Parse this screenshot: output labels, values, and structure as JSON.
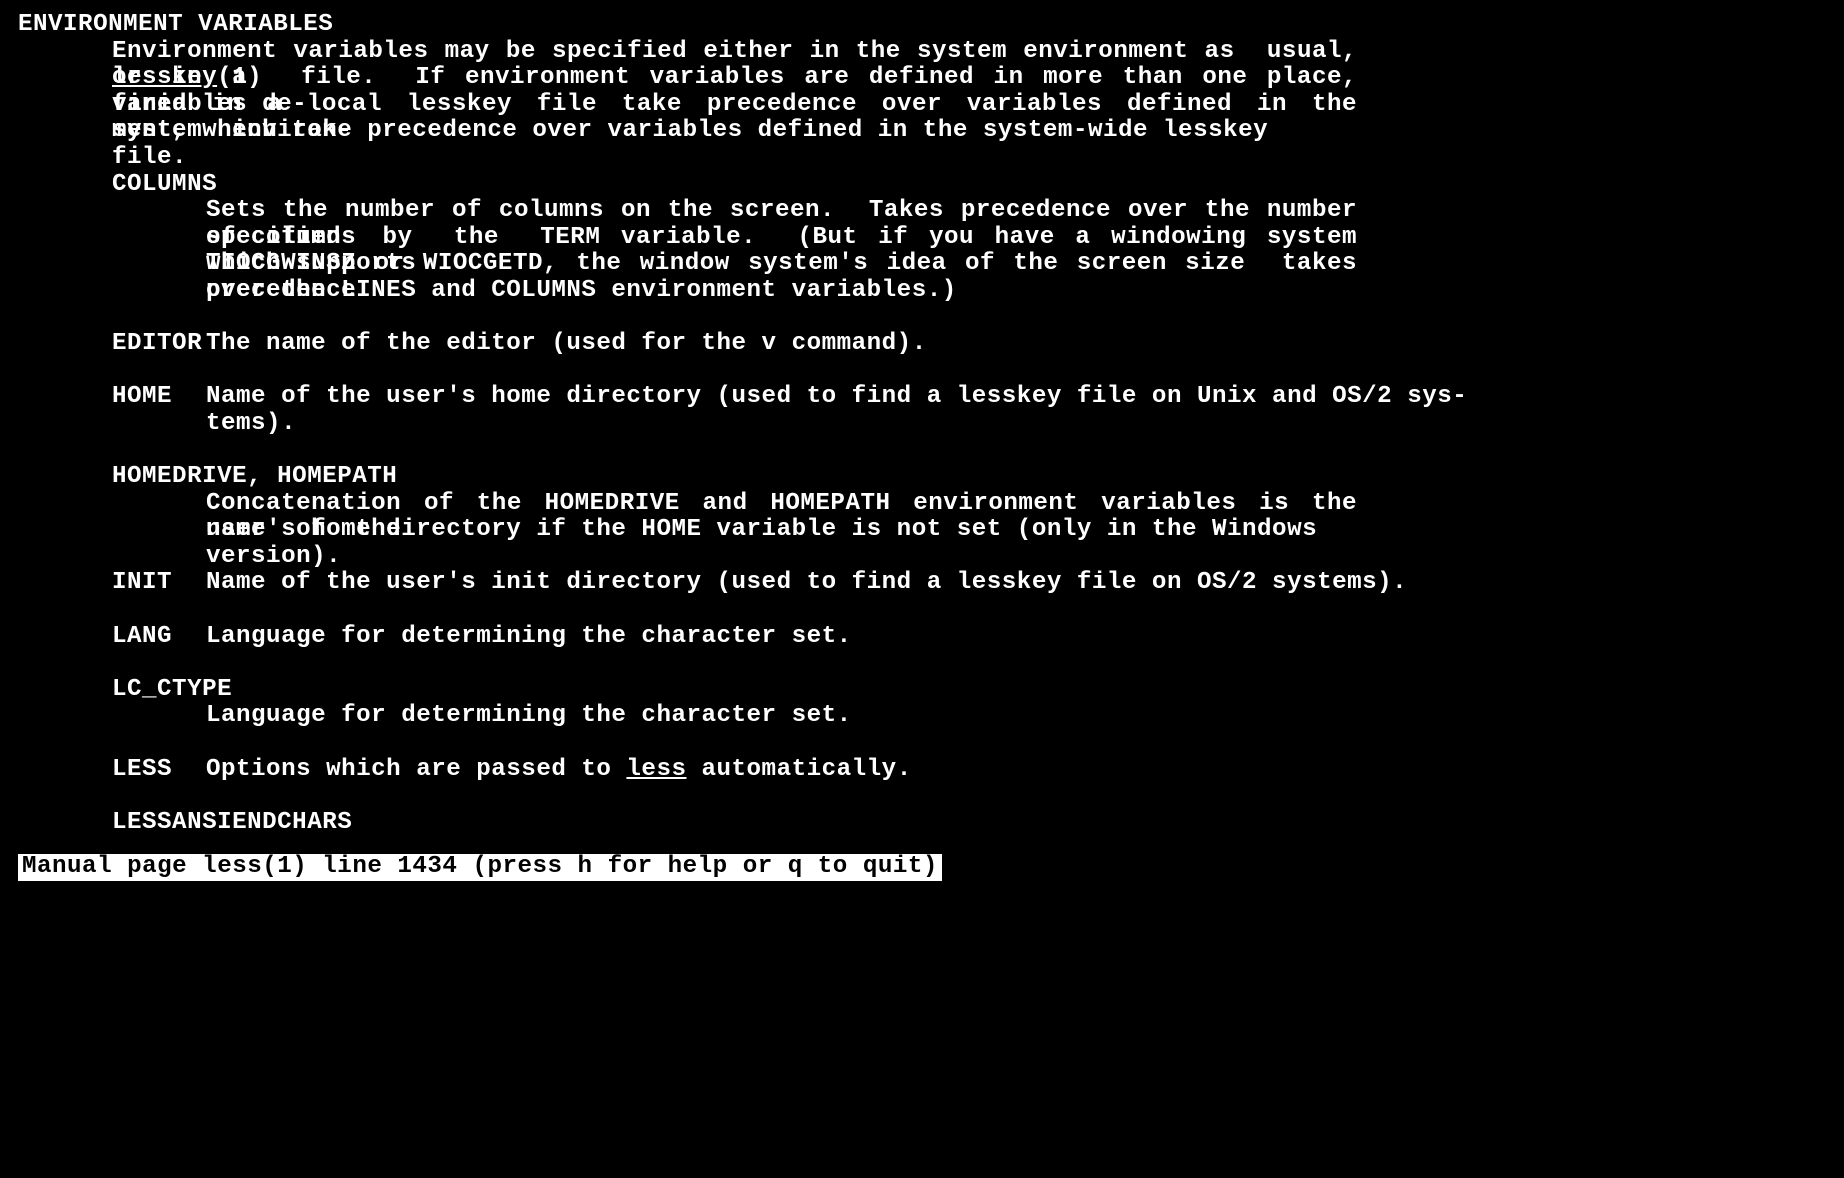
{
  "section": {
    "title": "ENVIRONMENT VARIABLES",
    "intro_l1_a": "Environment variables may be specified either in the system environment as  usual,  or  in  a",
    "intro_link": "lesskey",
    "intro_l2_a": "(1)  file.  If environment variables are defined in more than one place, variables de-",
    "intro_l3": "fined in a local lesskey file take precedence over variables defined in the  system  environ-",
    "intro_l4": "ment, which take precedence over variables defined in the system-wide lesskey file."
  },
  "vars": {
    "columns": {
      "name": "COLUMNS",
      "d1": "Sets the number of columns on the screen.  Takes precedence over the number of columns",
      "d2": "specified  by  the  TERM variable.  (But if you have a windowing system which supports",
      "d3": "TIOCGWINSZ or WIOCGETD, the window system's idea of the screen size  takes  precedence",
      "d4": "over the LINES and COLUMNS environment variables.)"
    },
    "editor": {
      "name": "EDITOR",
      "desc": "The name of the editor (used for the v command)."
    },
    "home": {
      "name": "HOME",
      "d1": "Name  of  the user's home directory (used to find a lesskey file on Unix and OS/2 sys-",
      "d2": "tems)."
    },
    "homedrive": {
      "name": "HOMEDRIVE, HOMEPATH",
      "d1": "Concatenation of the HOMEDRIVE and HOMEPATH environment variables is the name  of  the",
      "d2": "user's home directory if the HOME variable is not set (only in the Windows version)."
    },
    "init": {
      "name": "INIT",
      "desc": "Name of the user's init directory (used to find a lesskey file on OS/2 systems)."
    },
    "lang": {
      "name": "LANG",
      "desc": "Language for determining the character set."
    },
    "lc_ctype": {
      "name": "LC_CTYPE",
      "desc": "Language for determining the character set."
    },
    "less": {
      "name": "LESS",
      "d1a": "Options which are passed to ",
      "link": "less",
      "d1b": " automatically."
    },
    "lessansiendchars": {
      "name": "LESSANSIENDCHARS"
    }
  },
  "status": "Manual page less(1) line 1434 (press h for help or q to quit)"
}
